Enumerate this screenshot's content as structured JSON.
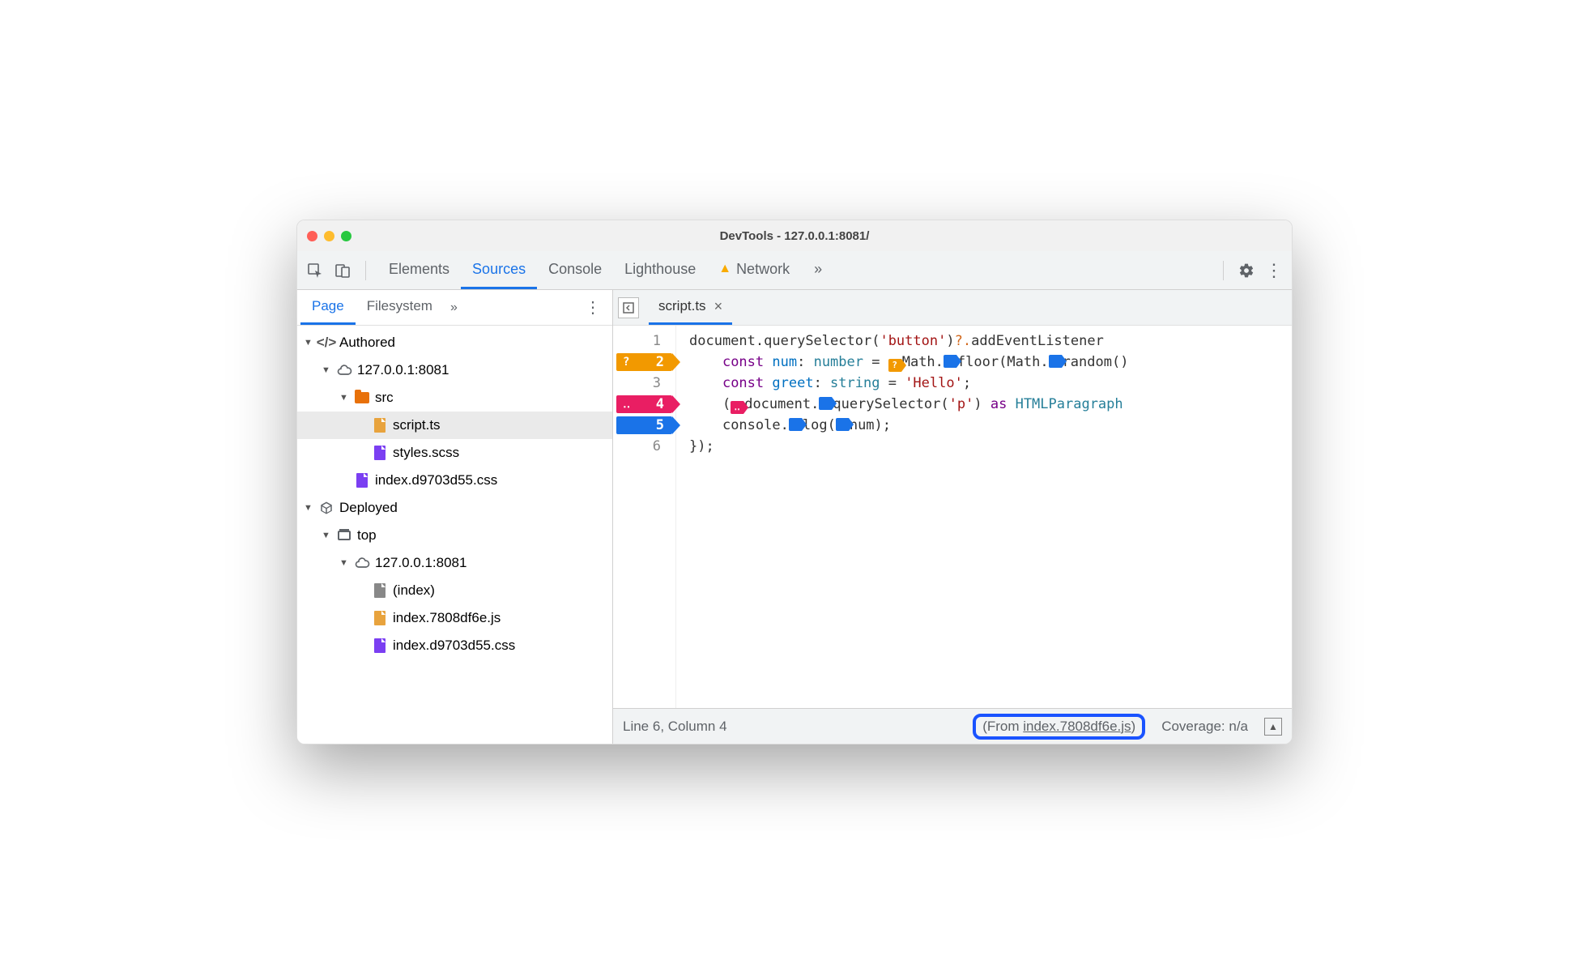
{
  "window": {
    "title": "DevTools - 127.0.0.1:8081/"
  },
  "tabs": {
    "items": [
      "Elements",
      "Sources",
      "Console",
      "Lighthouse",
      "Network"
    ],
    "active": "Sources",
    "overflow": "»",
    "network_warning": true
  },
  "sidebar": {
    "tabs": {
      "items": [
        "Page",
        "Filesystem"
      ],
      "active": "Page",
      "overflow": "»"
    },
    "tree": [
      {
        "d": 0,
        "label": "Authored",
        "icon": "code",
        "expandable": true,
        "open": true
      },
      {
        "d": 1,
        "label": "127.0.0.1:8081",
        "icon": "cloud",
        "expandable": true,
        "open": true
      },
      {
        "d": 2,
        "label": "src",
        "icon": "folder",
        "expandable": true,
        "open": true
      },
      {
        "d": 3,
        "label": "script.ts",
        "icon": "file-orange",
        "selected": true
      },
      {
        "d": 3,
        "label": "styles.scss",
        "icon": "file-purple"
      },
      {
        "d": 2,
        "label": "index.d9703d55.css",
        "icon": "file-purple"
      },
      {
        "d": 0,
        "label": "Deployed",
        "icon": "cube",
        "expandable": true,
        "open": true
      },
      {
        "d": 1,
        "label": "top",
        "icon": "frame",
        "expandable": true,
        "open": true
      },
      {
        "d": 2,
        "label": "127.0.0.1:8081",
        "icon": "cloud",
        "expandable": true,
        "open": true
      },
      {
        "d": 3,
        "label": "(index)",
        "icon": "file-grey"
      },
      {
        "d": 3,
        "label": "index.7808df6e.js",
        "icon": "file-orange"
      },
      {
        "d": 3,
        "label": "index.d9703d55.css",
        "icon": "file-purple"
      }
    ]
  },
  "editor": {
    "open_tab": "script.ts",
    "lines": [
      {
        "n": 1,
        "bp": null,
        "tokens": [
          {
            "t": "document",
            "c": "tk-d"
          },
          {
            "t": ".",
            "c": "tk-d"
          },
          {
            "t": "querySelector",
            "c": "tk-fn"
          },
          {
            "t": "(",
            "c": "tk-d"
          },
          {
            "t": "'button'",
            "c": "tk-s"
          },
          {
            "t": ")",
            "c": "tk-d"
          },
          {
            "t": "?.",
            "c": "tk-q"
          },
          {
            "t": "addEventListener",
            "c": "tk-fn"
          }
        ]
      },
      {
        "n": 2,
        "bp": "orange",
        "bppre": "?",
        "indent": "    ",
        "tokens": [
          {
            "t": "const ",
            "c": "tk-k"
          },
          {
            "t": "num",
            "c": "tk-kw2"
          },
          {
            "t": ": ",
            "c": "tk-d"
          },
          {
            "t": "number",
            "c": "tk-t"
          },
          {
            "t": " = ",
            "c": "tk-d"
          },
          {
            "ih": "or",
            "g": "?"
          },
          {
            "t": "Math",
            "c": "tk-d"
          },
          {
            "t": ".",
            "c": "tk-d"
          },
          {
            "ih": "bl"
          },
          {
            "t": "floor",
            "c": "tk-d"
          },
          {
            "t": "(",
            "c": "tk-d"
          },
          {
            "t": "Math",
            "c": "tk-d"
          },
          {
            "t": ".",
            "c": "tk-d"
          },
          {
            "ih": "bl"
          },
          {
            "t": "random",
            "c": "tk-d"
          },
          {
            "t": "()",
            "c": "tk-d"
          }
        ]
      },
      {
        "n": 3,
        "bp": null,
        "indent": "    ",
        "tokens": [
          {
            "t": "const ",
            "c": "tk-k"
          },
          {
            "t": "greet",
            "c": "tk-kw2"
          },
          {
            "t": ": ",
            "c": "tk-d"
          },
          {
            "t": "string",
            "c": "tk-t"
          },
          {
            "t": " = ",
            "c": "tk-d"
          },
          {
            "t": "'Hello'",
            "c": "tk-s"
          },
          {
            "t": ";",
            "c": "tk-d"
          }
        ]
      },
      {
        "n": 4,
        "bp": "pink",
        "bppre": "‥",
        "indent": "    ",
        "tokens": [
          {
            "t": "(",
            "c": "tk-d"
          },
          {
            "ih": "pk",
            "g": "‥"
          },
          {
            "t": "document",
            "c": "tk-d"
          },
          {
            "t": ".",
            "c": "tk-d"
          },
          {
            "ih": "bl"
          },
          {
            "t": "querySelector",
            "c": "tk-d"
          },
          {
            "t": "(",
            "c": "tk-d"
          },
          {
            "t": "'p'",
            "c": "tk-s"
          },
          {
            "t": ") ",
            "c": "tk-d"
          },
          {
            "t": "as ",
            "c": "tk-k"
          },
          {
            "t": "HTMLParagraph",
            "c": "tk-t"
          }
        ]
      },
      {
        "n": 5,
        "bp": "blue",
        "indent": "    ",
        "tokens": [
          {
            "t": "console",
            "c": "tk-d"
          },
          {
            "t": ".",
            "c": "tk-d"
          },
          {
            "ih": "bl"
          },
          {
            "t": "log",
            "c": "tk-d"
          },
          {
            "t": "(",
            "c": "tk-d"
          },
          {
            "ih": "bl"
          },
          {
            "t": "num",
            "c": "tk-d"
          },
          {
            "t": ");",
            "c": "tk-d"
          }
        ]
      },
      {
        "n": 6,
        "bp": null,
        "tokens": [
          {
            "t": "});",
            "c": "tk-d"
          }
        ]
      }
    ]
  },
  "status": {
    "cursor": "Line 6, Column 4",
    "from_prefix": "(From ",
    "from_link": "index.7808df6e.js",
    "from_suffix": ")",
    "coverage": "Coverage: n/a"
  }
}
